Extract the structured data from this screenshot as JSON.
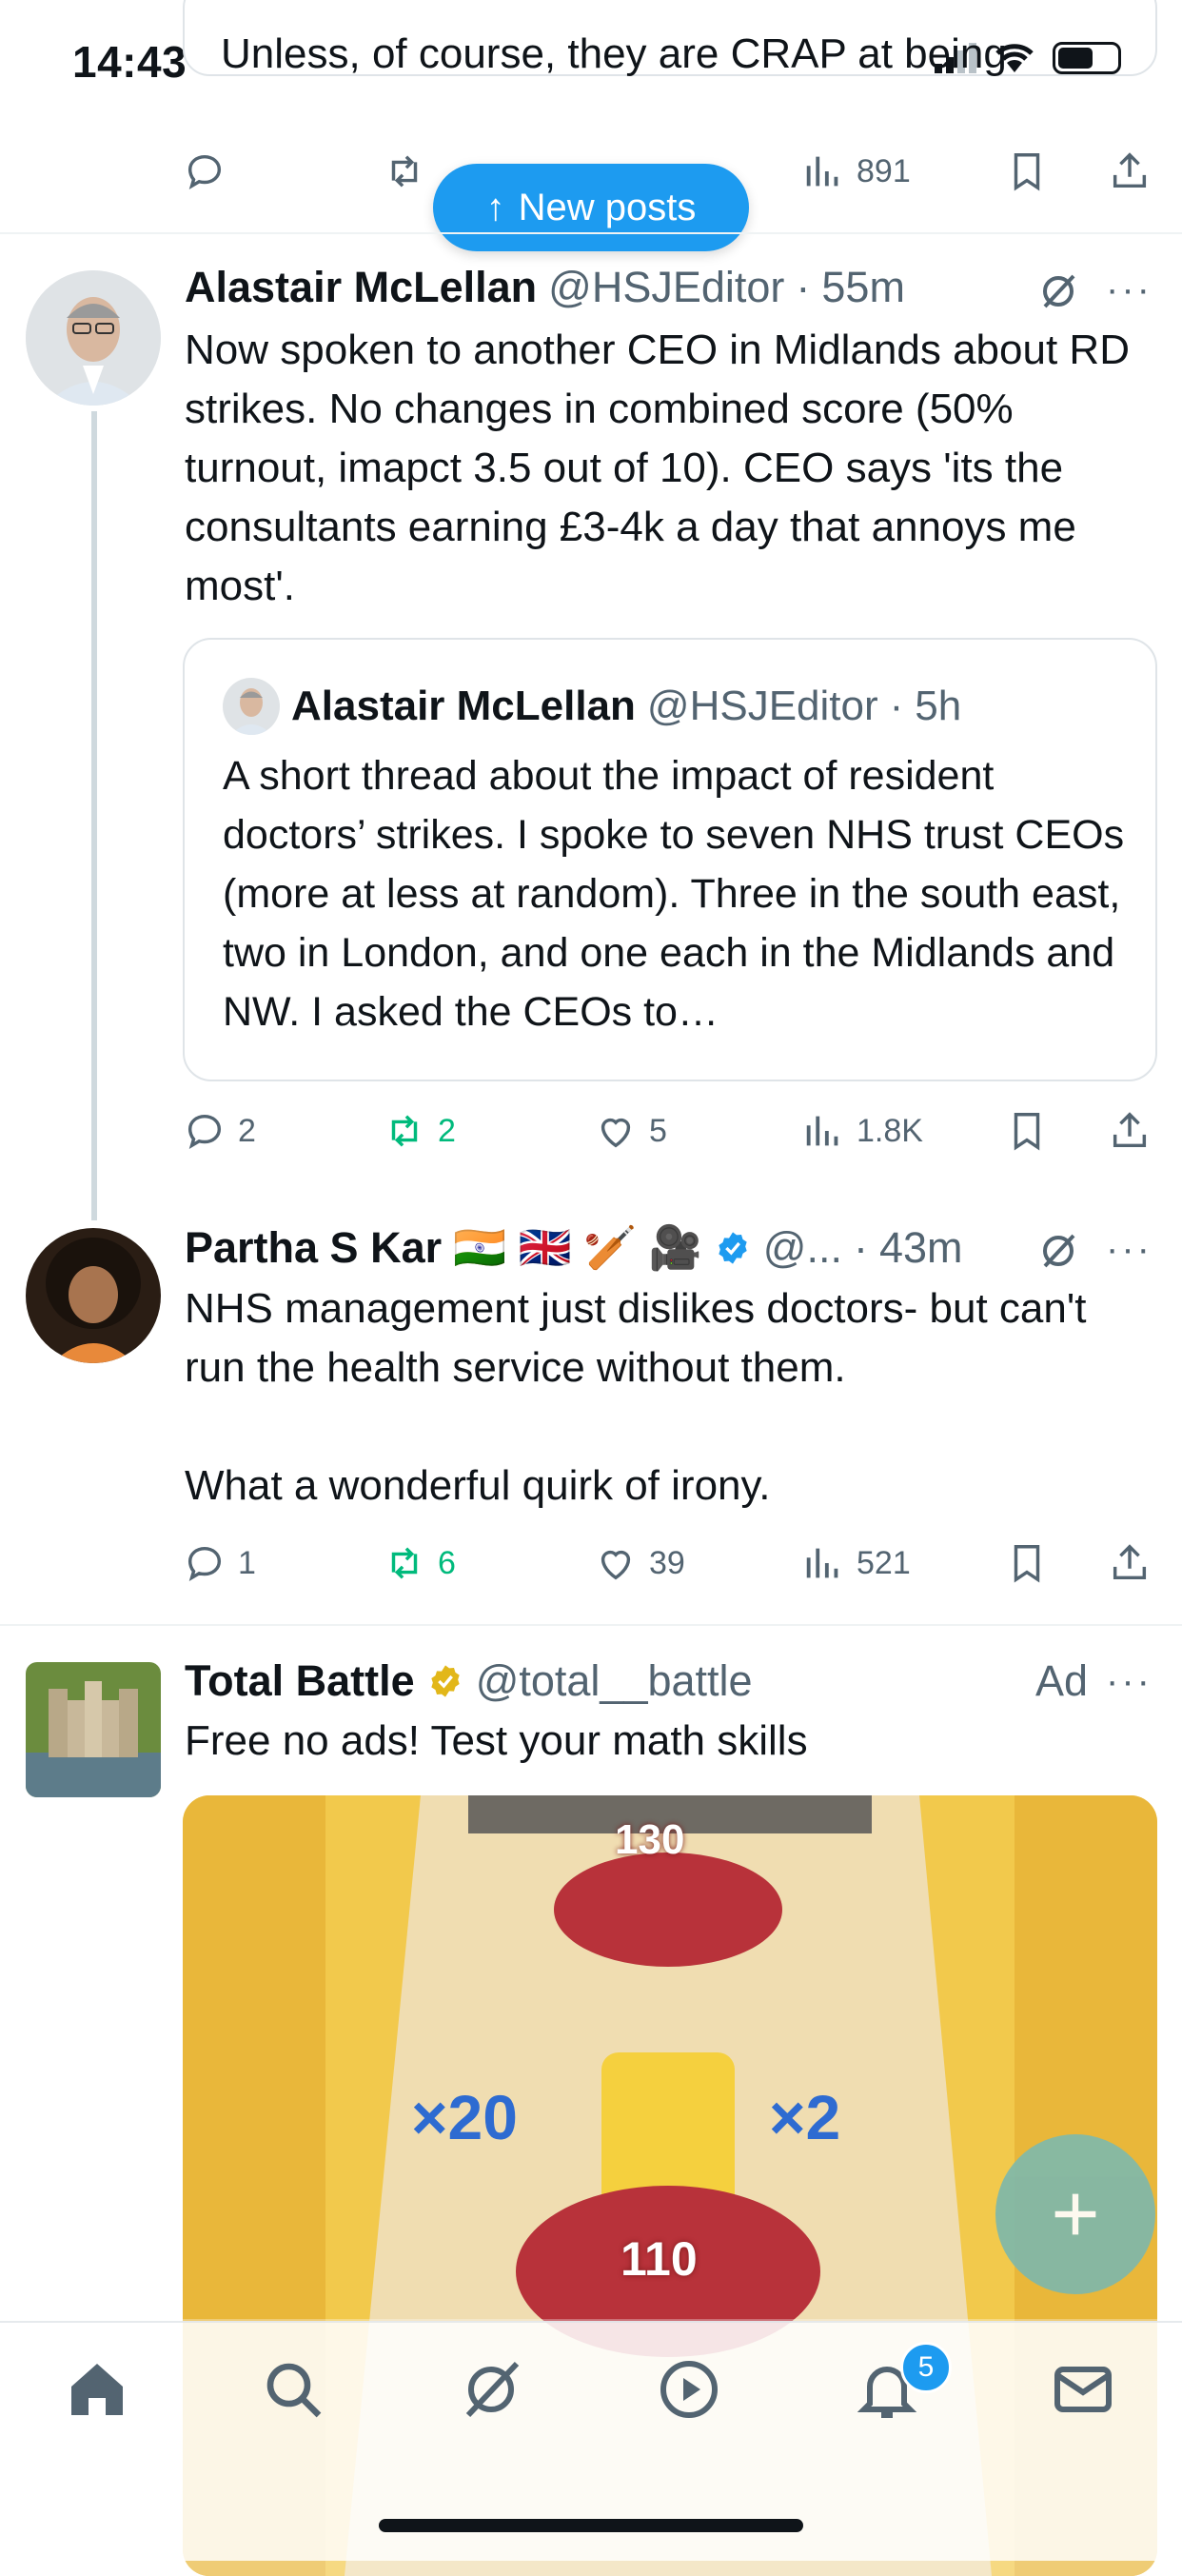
{
  "status_bar": {
    "time": "14:43"
  },
  "previous_tweet": {
    "text_fragment": "Unless, of course, they are CRAP at being.",
    "views": "891"
  },
  "new_posts_label": "New posts",
  "tweet1": {
    "name": "Alastair McLellan",
    "handle": "@HSJEditor",
    "sep": "·",
    "time": "55m",
    "text": "Now spoken to another CEO in Midlands about RD strikes. No changes in combined score (50% turnout, imapct 3.5 out of 10). CEO says 'its the consultants earning £3-4k a day that annoys me most'.",
    "quote": {
      "name": "Alastair McLellan",
      "handle": "@HSJEditor",
      "sep": "·",
      "time": "5h",
      "text": "A short thread about the impact of resident doctors’ strikes. I spoke to seven NHS trust CEOs (more at less at random). Three in the south east, two in London, and one each in the Midlands and NW. I asked the CEOs to…"
    },
    "replies": "2",
    "reposts": "2",
    "likes": "5",
    "views": "1.8K"
  },
  "tweet2": {
    "name": "Partha S Kar",
    "emojis": "🇮🇳 🇬🇧 🏏 🎥",
    "handle": "@...",
    "sep": "·",
    "time": "43m",
    "text_line1": "NHS management just dislikes doctors- but can't run the health service without them.",
    "text_line2": "What a wonderful quirk of irony.",
    "replies": "1",
    "reposts": "6",
    "likes": "39",
    "views": "521"
  },
  "ad": {
    "name": "Total Battle",
    "handle": "@total__battle",
    "ad_label": "Ad",
    "text": "Free no ads! Test your math skills",
    "game_numbers": {
      "top": "130",
      "left_gate": "×20",
      "right_gate": "×2",
      "bottom": "110"
    }
  },
  "notifications_badge": "5",
  "colors": {
    "accent": "#1d9bf0",
    "repost_green": "#00ba7c",
    "secondary_text": "#536471"
  },
  "icons": [
    "reply-icon",
    "repost-icon",
    "like-icon",
    "views-icon",
    "bookmark-icon",
    "share-icon",
    "grok-icon",
    "more-icon",
    "home-icon",
    "search-icon",
    "communities-icon",
    "video-icon",
    "notifications-icon",
    "messages-icon",
    "compose-icon",
    "verified-icon"
  ]
}
